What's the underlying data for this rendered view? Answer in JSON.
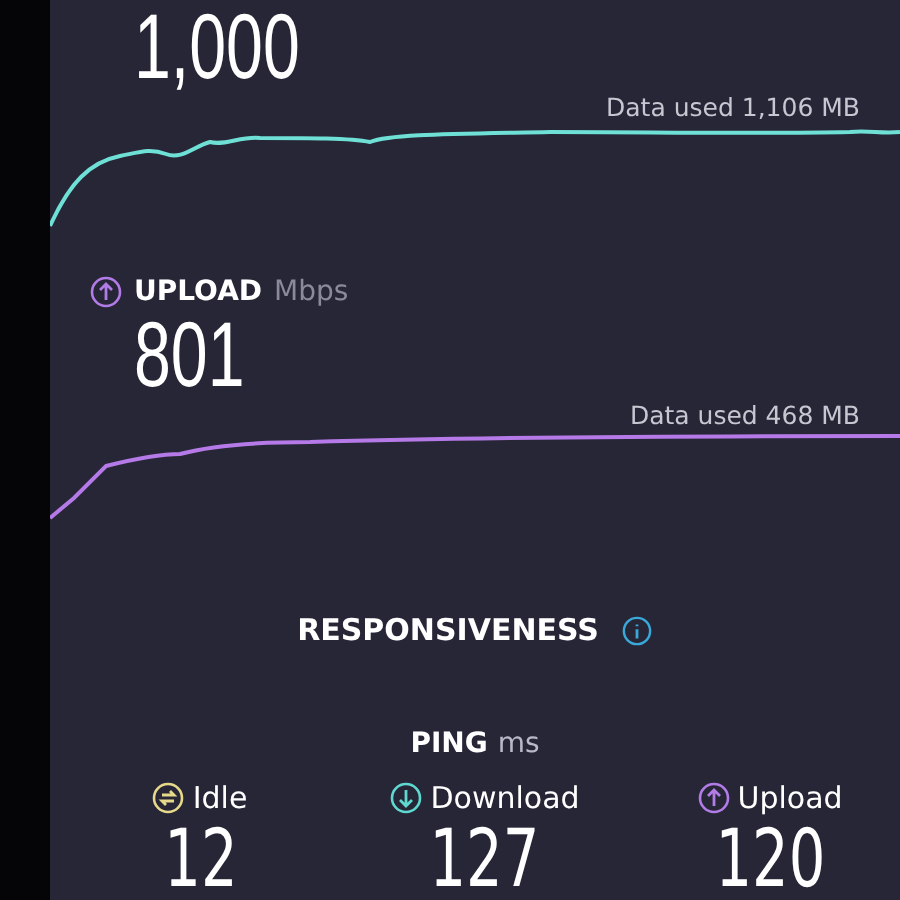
{
  "download": {
    "value": "1,000",
    "data_used": "Data used 1,106 MB"
  },
  "upload": {
    "label": "UPLOAD",
    "unit": "Mbps",
    "value": "801",
    "data_used": "Data used 468 MB"
  },
  "responsiveness": {
    "title": "RESPONSIVENESS"
  },
  "ping": {
    "label": "PING",
    "unit": "ms",
    "items": [
      {
        "kind": "idle",
        "label": "Idle",
        "value": "12"
      },
      {
        "kind": "download",
        "label": "Download",
        "value": "127"
      },
      {
        "kind": "upload",
        "label": "Upload",
        "value": "120"
      }
    ]
  }
}
